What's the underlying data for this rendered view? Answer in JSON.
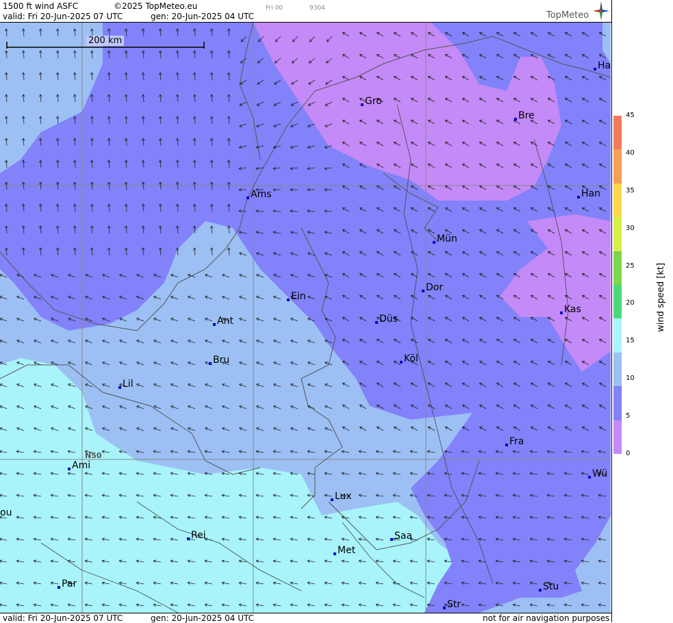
{
  "header": {
    "product": "1500 ft wind ASFC",
    "copyright": "©2025 TopMeteo.eu",
    "day_code": "Fri 00",
    "code": "9304",
    "valid": "valid:  Fri  20-Jun-2025  07 UTC",
    "gen": "gen: 20-Jun-2025 04 UTC",
    "logo": "TopMeteo"
  },
  "footer": {
    "valid": "valid:  Fri  20-Jun-2025  07 UTC",
    "gen": "gen: 20-Jun-2025 04 UTC",
    "disclaimer": "not for air navigation purposes"
  },
  "map": {
    "scale_label": "200 km",
    "lat_label": "N50",
    "cities": [
      {
        "label": "Gro"
      },
      {
        "label": "Bre"
      },
      {
        "label": "Ha"
      },
      {
        "label": "Ams"
      },
      {
        "label": "Han"
      },
      {
        "label": "Mün"
      },
      {
        "label": "Dor"
      },
      {
        "label": "Ein"
      },
      {
        "label": "Kas"
      },
      {
        "label": "Ant"
      },
      {
        "label": "Düs"
      },
      {
        "label": "Bru"
      },
      {
        "label": "Köl"
      },
      {
        "label": "Lil"
      },
      {
        "label": "Fra"
      },
      {
        "label": "Ami"
      },
      {
        "label": "Wü"
      },
      {
        "label": "Lux"
      },
      {
        "label": "ou"
      },
      {
        "label": "Rei"
      },
      {
        "label": "Saa"
      },
      {
        "label": "Met"
      },
      {
        "label": "Par"
      },
      {
        "label": "Stu"
      },
      {
        "label": "Str"
      }
    ]
  },
  "legend": {
    "title": "wind  speed  [kt]",
    "ticks": [
      "45",
      "40",
      "35",
      "30",
      "25",
      "20",
      "15",
      "10",
      "5",
      "0"
    ],
    "colors": [
      "#f47a5c",
      "#f7a055",
      "#fcd84a",
      "#d6f04a",
      "#7ed64a",
      "#4ad87a",
      "#a8f4fa",
      "#9cc0f4",
      "#8282fa",
      "#c48af7"
    ]
  }
}
